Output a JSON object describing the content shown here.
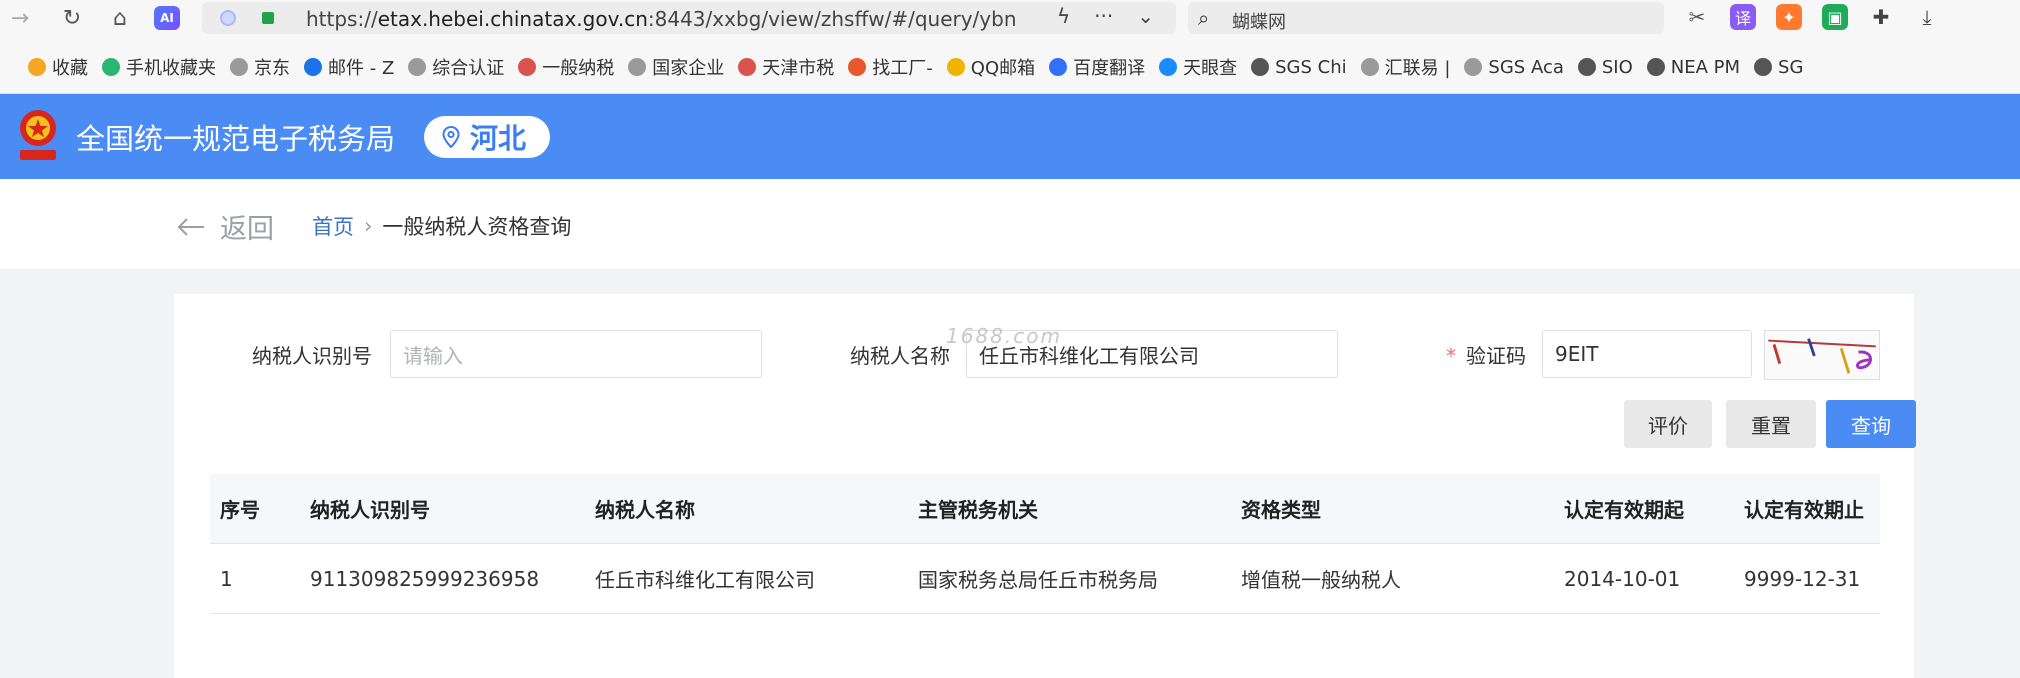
{
  "browser": {
    "url_prefix": "https://",
    "url_host": "etax.hebei.chinatax.gov.cn",
    "url_rest": ":8443/xxbg/view/zhsffw/#/query/ybn",
    "ai_label": "AI",
    "search_query": "蝴蝶网",
    "bookmarks": [
      {
        "label": "收藏",
        "color": "#f5a623"
      },
      {
        "label": "手机收藏夹",
        "color": "#2bb673"
      },
      {
        "label": "京东",
        "color": "#9a9a9a"
      },
      {
        "label": "邮件 - Z",
        "color": "#1a73e8"
      },
      {
        "label": "综合认证",
        "color": "#9a9a9a"
      },
      {
        "label": "一般纳税",
        "color": "#d9534f"
      },
      {
        "label": "国家企业",
        "color": "#9a9a9a"
      },
      {
        "label": "天津市税",
        "color": "#d9534f"
      },
      {
        "label": "找工厂-",
        "color": "#e8582d"
      },
      {
        "label": "QQ邮箱",
        "color": "#f0b400"
      },
      {
        "label": "百度翻译",
        "color": "#3370ff"
      },
      {
        "label": "天眼查",
        "color": "#1a8cff"
      },
      {
        "label": "SGS Chi",
        "color": "#555555"
      },
      {
        "label": "汇联易 |",
        "color": "#9a9a9a"
      },
      {
        "label": "SGS Aca",
        "color": "#9a9a9a"
      },
      {
        "label": "SIO",
        "color": "#555555"
      },
      {
        "label": "NEA PM",
        "color": "#555555"
      },
      {
        "label": "SG",
        "color": "#555555"
      }
    ]
  },
  "site": {
    "title": "全国统一规范电子税务局",
    "province": "河北",
    "brand_color": "#4b8bf4"
  },
  "breadcrumb": {
    "back": "返回",
    "home": "首页",
    "separator": "›",
    "current": "一般纳税人资格查询"
  },
  "form": {
    "taxpayer_id_label": "纳税人识别号",
    "taxpayer_id_placeholder": "请输入",
    "taxpayer_name_label": "纳税人名称",
    "taxpayer_name_value": "任丘市科维化工有限公司",
    "captcha_required": "*",
    "captcha_label": "验证码",
    "captcha_value": "9EIT",
    "watermark": "1688.com"
  },
  "buttons": {
    "evaluate": "评价",
    "reset": "重置",
    "query": "查询"
  },
  "table": {
    "headers": [
      "序号",
      "纳税人识别号",
      "纳税人名称",
      "主管税务机关",
      "资格类型",
      "认定有效期起",
      "认定有效期止"
    ],
    "rows": [
      [
        "1",
        "911309825999236958",
        "任丘市科维化工有限公司",
        "国家税务总局任丘市税务局",
        "增值税一般纳税人",
        "2014-10-01",
        "9999-12-31"
      ]
    ]
  }
}
